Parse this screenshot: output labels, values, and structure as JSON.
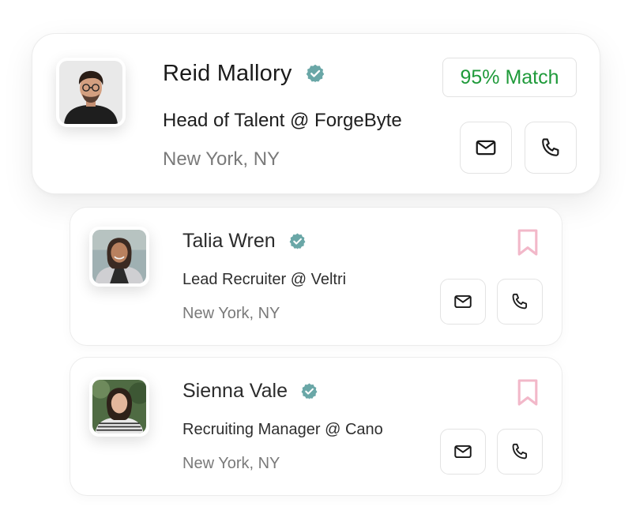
{
  "colors": {
    "match_green": "#1f9a3a",
    "verified_teal": "#6aa7a7",
    "bookmark_pink": "#f2b8c9",
    "text_dark": "#1b1b1b",
    "text_muted": "#7a7a7a"
  },
  "icons": {
    "verified": "verified-badge-icon",
    "mail": "mail-icon",
    "phone": "phone-icon",
    "bookmark": "bookmark-icon"
  },
  "contacts": [
    {
      "name": "Reid Mallory",
      "verified": true,
      "role": "Head of Talent @ ForgeByte",
      "location": "New York, NY",
      "match": "95% Match"
    },
    {
      "name": "Talia Wren",
      "verified": true,
      "role": "Lead Recruiter @ Veltri",
      "location": "New York, NY",
      "bookmarked": false
    },
    {
      "name": "Sienna Vale",
      "verified": true,
      "role": "Recruiting Manager @ Cano",
      "location": "New York, NY",
      "bookmarked": false
    }
  ]
}
